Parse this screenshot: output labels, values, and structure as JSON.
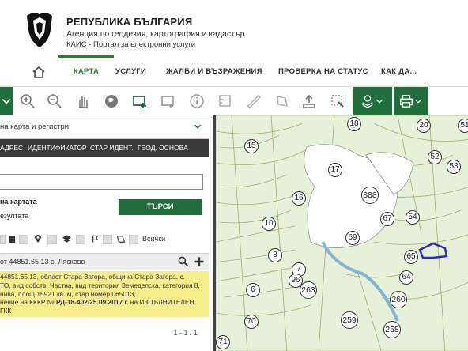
{
  "header": {
    "title": "РЕПУБЛИКА БЪЛГАРИЯ",
    "agency": "Агенция по геодезия, картография и кадастър",
    "portal": "КАИС - Портал за електронни услуги"
  },
  "nav": {
    "items": [
      "КАРТА",
      "УСЛУГИ",
      "ЖАЛБИ И ВЪЗРАЖЕНИЯ",
      "ПРОВЕРКА НА СТАТУС",
      "КАК ДА..."
    ]
  },
  "panel": {
    "layer_select": "на карта и регистри",
    "tabs": [
      "АДРЕС",
      "ИДЕНТИФИКАТОР",
      "СТАР ИДЕНТ.",
      "ГЕОД. ОСНОВА"
    ],
    "search_value": "",
    "label_on_map": "на картата",
    "label_result": "езултата",
    "search_button": "ТЪРСИ",
    "filter_all": "Всички",
    "result_header": "от 44851.65.13 с. Лясково",
    "result_text_1": "44851.65.13, област Стара Загора, община Стара Загора, с.",
    "result_text_2": "ТО, вид собств. Частна, вид територия Земеделска, категория 8,",
    "result_text_3": "нива, площ 15921 кв. м, стар номер 065013,",
    "result_text_4_pre": "нение на КККР № ",
    "result_text_4_bold": "РД-18-402/25.09.2017 г.",
    "result_text_4_post": " на ИЗПЪЛНИТЕЛЕН",
    "result_text_5": "ГКК",
    "pager": "1 - 1 / 1"
  },
  "map": {
    "parcels": [
      "18",
      "20",
      "51",
      "15",
      "52",
      "53",
      "17",
      "888",
      "16",
      "54",
      "67",
      "10",
      "69",
      "65",
      "8",
      "7",
      "96",
      "64",
      "6",
      "263",
      "260",
      "70",
      "259",
      "258",
      "71"
    ]
  },
  "colors": {
    "accent": "#1f6e3c",
    "highlight": "#f7ec8a"
  }
}
